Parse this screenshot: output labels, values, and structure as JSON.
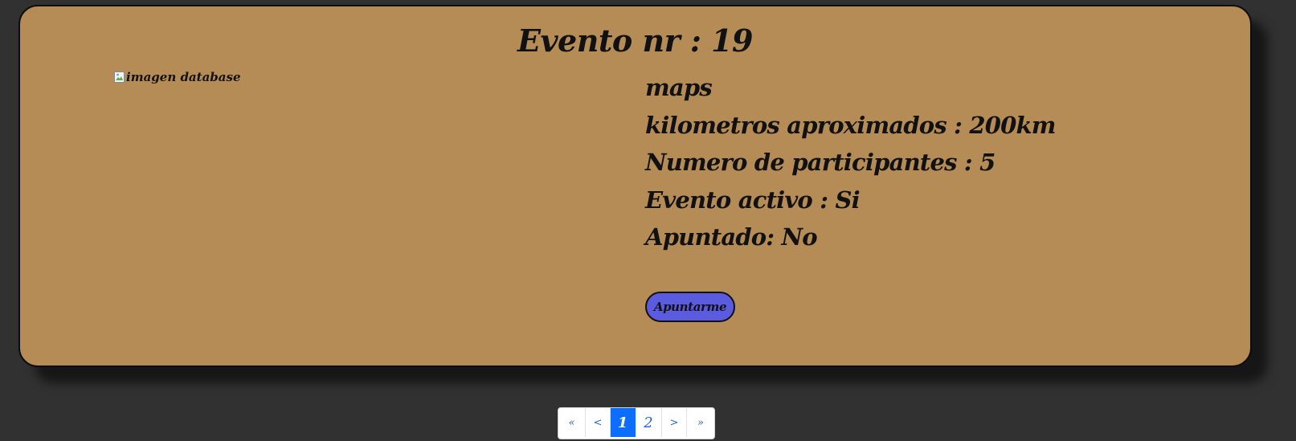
{
  "event": {
    "title": "Evento nr : 19",
    "image_alt": "imagen database",
    "details": [
      "maps",
      "kilometros aproximados : 200km",
      "Numero de participantes : 5",
      "Evento activo : Si",
      "Apuntado: No"
    ],
    "join_label": "Apuntarme"
  },
  "pagination": {
    "first": "«",
    "prev": "<",
    "pages": [
      "1",
      "2"
    ],
    "active_page": "1",
    "next": ">",
    "last": "»"
  },
  "colors": {
    "page_bg": "#313131",
    "card_bg": "#b68c56",
    "button_bg": "#5b5be0",
    "pagination_active": "#0d6efd"
  }
}
